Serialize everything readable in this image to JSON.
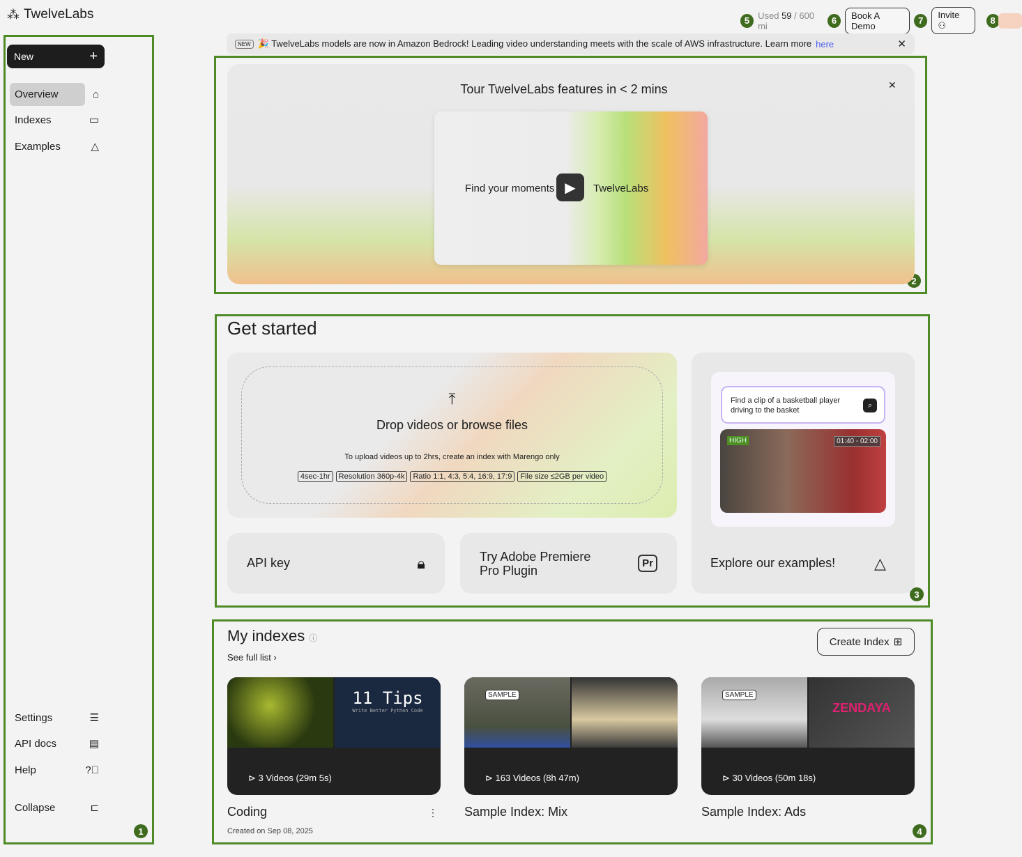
{
  "header": {
    "brand": "TwelveLabs",
    "usage_prefix": "Used",
    "usage_used": "59",
    "usage_total": "/ 600 mi",
    "book_demo": "Book A Demo",
    "invite": "Invite"
  },
  "sidebar": {
    "new_label": "New",
    "items": [
      {
        "label": "Overview"
      },
      {
        "label": "Indexes"
      },
      {
        "label": "Examples"
      }
    ],
    "bottom": [
      {
        "label": "Settings"
      },
      {
        "label": "API docs"
      },
      {
        "label": "Help"
      },
      {
        "label": "Collapse"
      }
    ]
  },
  "banner": {
    "tag": "NEW",
    "text": "🎉 TwelveLabs models are now in Amazon Bedrock! Leading video understanding meets with the scale of AWS infrastructure. Learn more",
    "link": "here"
  },
  "tour": {
    "title": "Tour TwelveLabs features in < 2 mins",
    "video_text": "Find your moments with",
    "video_brand": "TwelveLabs"
  },
  "get_started": {
    "title": "Get started",
    "drop_title": "Drop videos or browse files",
    "drop_note": "To upload videos up to 2hrs, create an index with Marengo only",
    "tags": [
      "4sec-1hr",
      "Resolution 360p-4k",
      "Ratio 1:1, 4:3, 5:4, 16:9, 17:9",
      "File size ≤2GB per video"
    ],
    "api_key": "API key",
    "premiere": "Try Adobe Premiere Pro Plugin",
    "examples": "Explore our examples!",
    "example_query": "Find a clip of a basketball player driving to the basket",
    "example_badge": "HIGH",
    "example_time": "01:40 - 02:00"
  },
  "indexes": {
    "title": "My indexes",
    "see_full": "See full list",
    "create": "Create Index",
    "items": [
      {
        "name": "Coding",
        "meta": "3 Videos (29m 5s)",
        "created": "Created on Sep 08, 2025",
        "thumb_text": "11 Tips",
        "thumb_sub": "Write Better Python Code"
      },
      {
        "name": "Sample Index: Mix",
        "meta": "163 Videos (8h 47m)",
        "sample": "SAMPLE"
      },
      {
        "name": "Sample Index: Ads",
        "meta": "30 Videos (50m 18s)",
        "sample": "SAMPLE",
        "thumb_text": "ZENDAYA"
      }
    ]
  },
  "annotations": [
    "1",
    "2",
    "3",
    "4",
    "5",
    "6",
    "7",
    "8"
  ]
}
